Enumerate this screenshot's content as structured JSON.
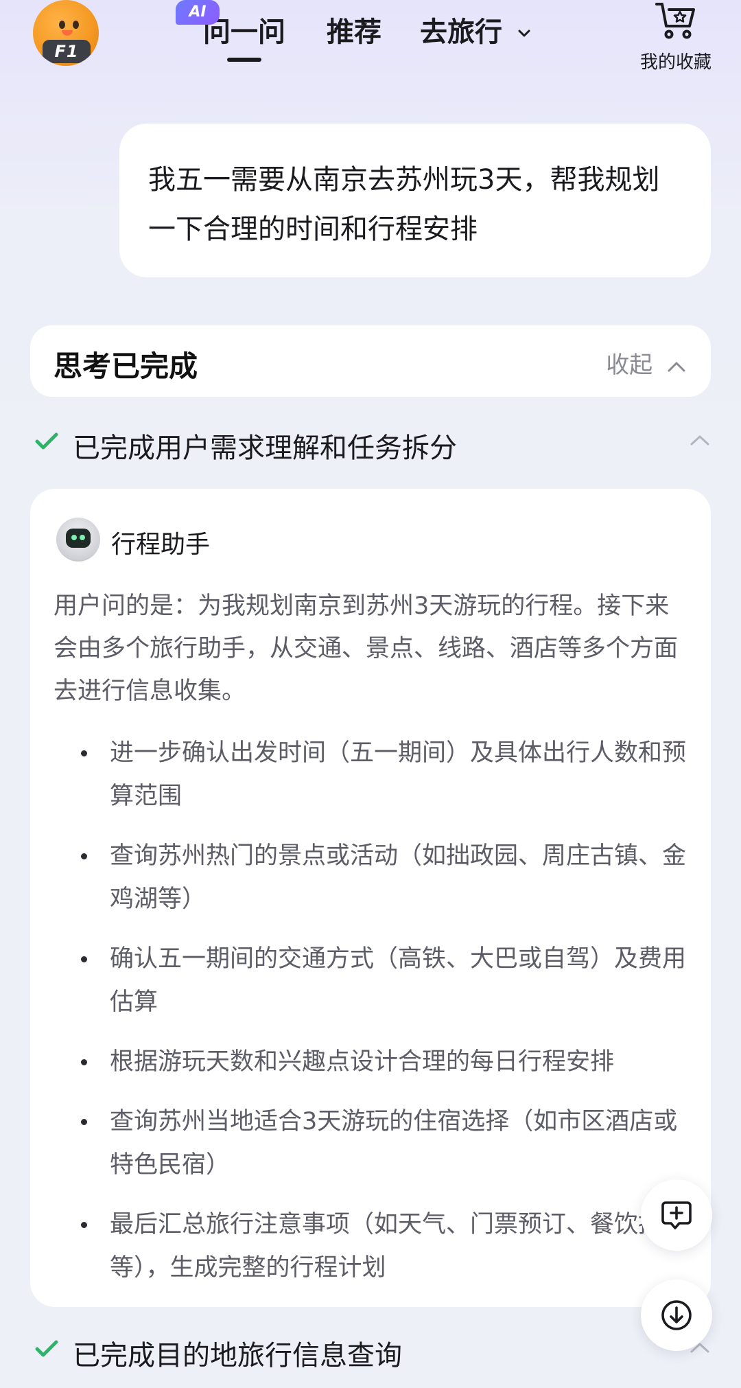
{
  "header": {
    "avatar_badge": "F1",
    "ai_badge": "AI",
    "tabs": [
      {
        "label": "问一问",
        "active": true
      },
      {
        "label": "推荐",
        "active": false
      },
      {
        "label": "去旅行",
        "active": false
      }
    ],
    "favorites_label": "我的收藏"
  },
  "user_message": "我五一需要从南京去苏州玩3天，帮我规划一下合理的时间和行程安排",
  "thinking": {
    "title": "思考已完成",
    "collapse_label": "收起"
  },
  "steps": [
    {
      "label": "已完成用户需求理解和任务拆分",
      "status": "done",
      "expanded": true
    },
    {
      "label": "已完成目的地旅行信息查询",
      "status": "done",
      "expanded": false
    }
  ],
  "assistant": {
    "name": "行程助手",
    "intro": "用户问的是：为我规划南京到苏州3天游玩的行程。接下来会由多个旅行助手，从交通、景点、线路、酒店等多个方面去进行信息收集。",
    "items": [
      "进一步确认出发时间（五一期间）及具体出行人数和预算范围",
      "查询苏州热门的景点或活动（如拙政园、周庄古镇、金鸡湖等）",
      "确认五一期间的交通方式（高铁、大巴或自驾）及费用估算",
      "根据游玩天数和兴趣点设计合理的每日行程安排",
      "查询苏州当地适合3天游玩的住宿选择（如市区酒店或特色民宿）",
      "最后汇总旅行注意事项（如天气、门票预订、餐饮推荐等），生成完整的行程计划"
    ]
  },
  "colors": {
    "check_green": "#2fb36b",
    "muted_text": "#5c5d66",
    "ai_badge": "#6d7bff"
  },
  "icons": {
    "favorites": "cart-star-icon",
    "check": "check-icon",
    "collapse": "chevron-up-icon",
    "new_chat": "new-chat-icon",
    "scroll_down": "arrow-down-circle-icon"
  }
}
